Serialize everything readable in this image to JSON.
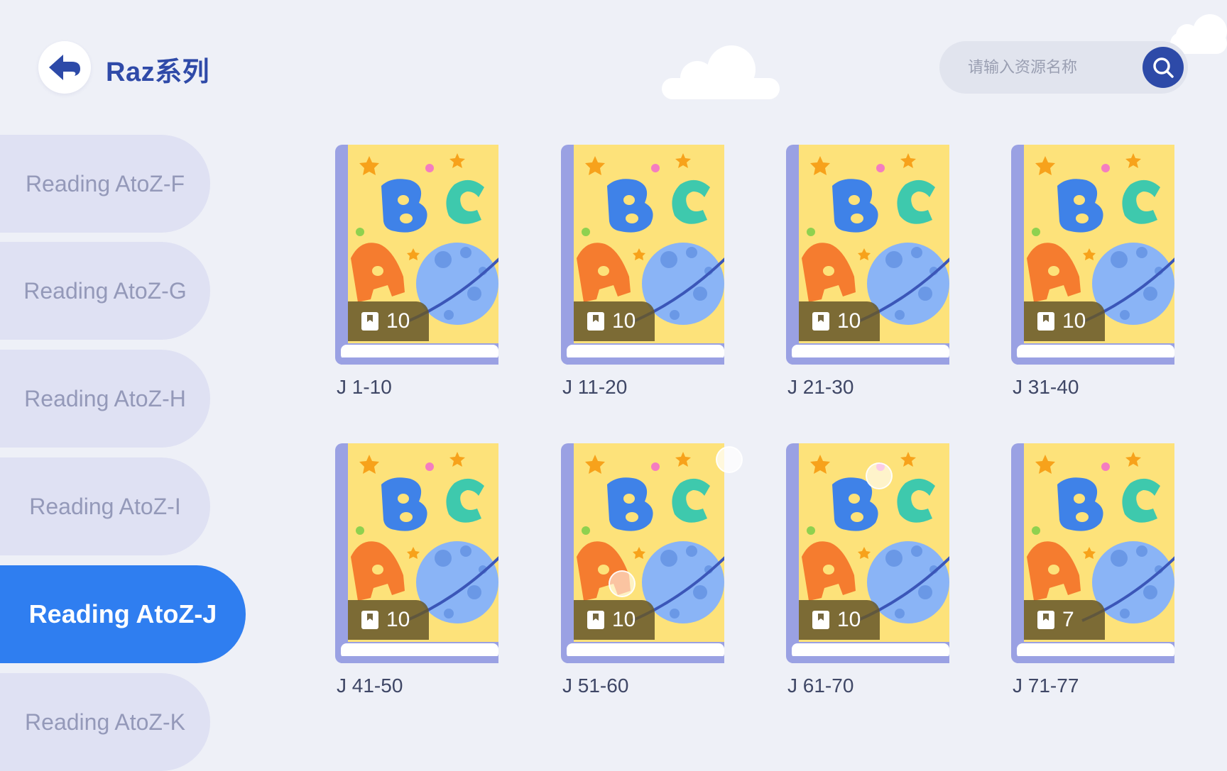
{
  "header": {
    "title": "Raz系列"
  },
  "search": {
    "placeholder": "请输入资源名称"
  },
  "sidebar": {
    "items": [
      {
        "label": "Reading AtoZ-F",
        "active": false
      },
      {
        "label": "Reading AtoZ-G",
        "active": false
      },
      {
        "label": "Reading AtoZ-H",
        "active": false
      },
      {
        "label": "Reading AtoZ-I",
        "active": false
      },
      {
        "label": "Reading AtoZ-J",
        "active": true
      },
      {
        "label": "Reading AtoZ-K",
        "active": false
      }
    ]
  },
  "books": [
    {
      "label": "J 1-10",
      "count": "10"
    },
    {
      "label": "J 11-20",
      "count": "10"
    },
    {
      "label": "J 21-30",
      "count": "10"
    },
    {
      "label": "J 31-40",
      "count": "10"
    },
    {
      "label": "J 41-50",
      "count": "10"
    },
    {
      "label": "J 51-60",
      "count": "10"
    },
    {
      "label": "J 61-70",
      "count": "10"
    },
    {
      "label": "J 71-77",
      "count": "7"
    }
  ],
  "icons": {
    "back": "arrow-left-icon",
    "search": "search-icon",
    "badge": "bookmark-icon"
  },
  "colors": {
    "accent": "#2f7ef0",
    "title": "#2f4aa8",
    "background": "#eef0f7",
    "sidebar_item": "#dfe1f3"
  }
}
